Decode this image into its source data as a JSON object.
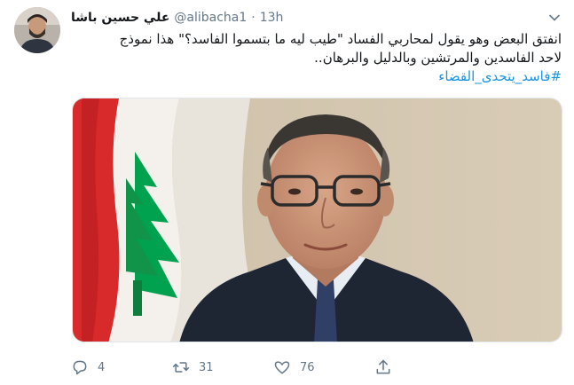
{
  "tweet": {
    "author_name": "علي حسين باشا",
    "handle": "@alibacha1",
    "separator": "·",
    "time": "13h",
    "text_line1": "انفتق البعض وهو يقول لمحاربي الفساد \"طيب ليه ما بتسموا الفاسد؟\" هذا نموذج",
    "text_line2": "لاحد الفاسدين والمرتشين وبالدليل والبرهان..",
    "hashtag": "#فاسد_يتحدى_القضاء",
    "reply_count": "4",
    "retweet_count": "31",
    "like_count": "76"
  },
  "icons": {
    "caret": "chevron-down-icon",
    "reply": "speech-bubble-icon",
    "retweet": "retweet-arrows-icon",
    "like": "heart-icon",
    "share": "share-upload-icon"
  },
  "colors": {
    "link": "#1b95e0",
    "muted": "#657786",
    "flag_red": "#d92a2b",
    "cedar_green": "#00a14f"
  }
}
